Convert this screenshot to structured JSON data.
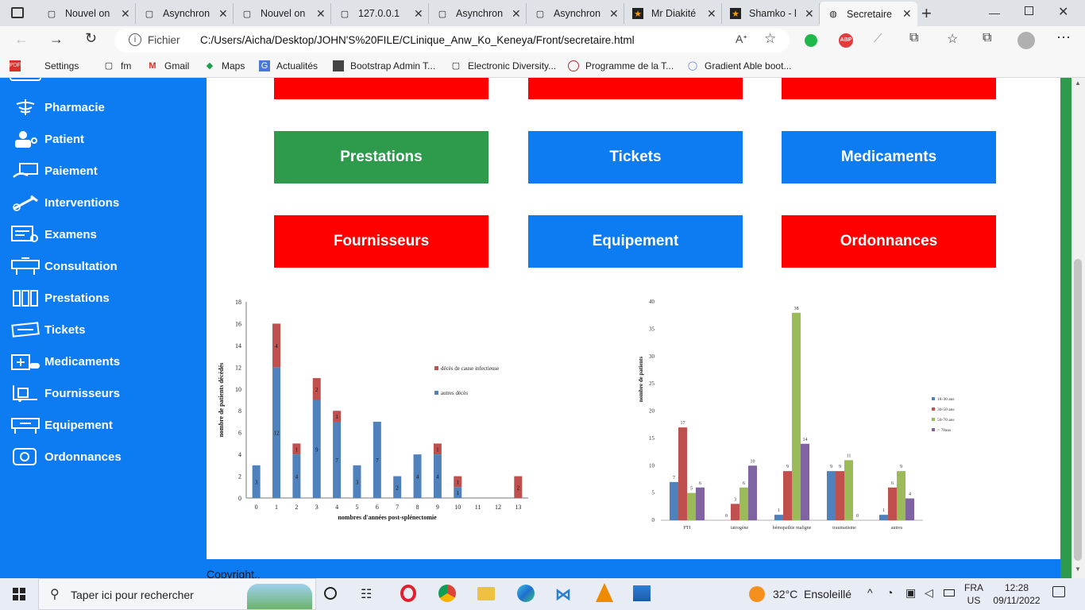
{
  "browser": {
    "tabs": [
      {
        "label": "Nouvel on",
        "icon": "page-icon"
      },
      {
        "label": "Asynchron",
        "icon": "page-icon"
      },
      {
        "label": "Nouvel on",
        "icon": "page-icon"
      },
      {
        "label": "127.0.0.1",
        "icon": "page-icon"
      },
      {
        "label": "Asynchron",
        "icon": "page-icon"
      },
      {
        "label": "Asynchron",
        "icon": "page-icon"
      },
      {
        "label": "Mr Diakité",
        "icon": "star-icon"
      },
      {
        "label": "Shamko - l",
        "icon": "star-icon"
      },
      {
        "label": "Secretaire",
        "icon": "globe-icon"
      }
    ],
    "address_label": "Fichier",
    "url": "C:/Users/Aicha/Desktop/JOHN'S%20FILE/CLinique_Anw_Ko_Keneya/Front/secretaire.html",
    "bookmarks": [
      "Settings",
      "fm",
      "Gmail",
      "Maps",
      "Actualités",
      "Bootstrap Admin T...",
      "Electronic Diversity...",
      "Programme de la T...",
      "Gradient Able boot..."
    ]
  },
  "sidebar": {
    "items": [
      {
        "label": "Pharmacie"
      },
      {
        "label": "Patient"
      },
      {
        "label": "Paiement"
      },
      {
        "label": "Interventions"
      },
      {
        "label": "Examens"
      },
      {
        "label": "Consultation"
      },
      {
        "label": "Prestations"
      },
      {
        "label": "Tickets"
      },
      {
        "label": "Medicaments"
      },
      {
        "label": "Fournisseurs"
      },
      {
        "label": "Equipement"
      },
      {
        "label": "Ordonnances"
      }
    ]
  },
  "main": {
    "tiles": [
      {
        "label": "Prestations",
        "color": "#2e9b4c"
      },
      {
        "label": "Tickets",
        "color": "#0d7cf2"
      },
      {
        "label": "Medicaments",
        "color": "#0d7cf2"
      },
      {
        "label": "Fournisseurs",
        "color": "#ff0000"
      },
      {
        "label": "Equipement",
        "color": "#0d7cf2"
      },
      {
        "label": "Ordonnances",
        "color": "#ff0000"
      }
    ],
    "copyright": "Copyright.."
  },
  "chart_data": [
    {
      "type": "bar",
      "stacked": true,
      "categories": [
        "0",
        "1",
        "2",
        "3",
        "4",
        "5",
        "6",
        "7",
        "8",
        "9",
        "10",
        "11",
        "12",
        "13"
      ],
      "series": [
        {
          "name": "autres décès",
          "values": [
            3,
            12,
            4,
            9,
            7,
            3,
            7,
            2,
            4,
            4,
            1,
            0,
            0,
            0
          ],
          "color": "#4f81bd"
        },
        {
          "name": "décès de cause infectieuse",
          "values": [
            0,
            4,
            1,
            2,
            1,
            0,
            0,
            0,
            0,
            1,
            1,
            0,
            0,
            2
          ],
          "color": "#c0504d"
        }
      ],
      "xlabel": "nombres d'années post-splénectomie",
      "ylabel": "nombre de patients décédés",
      "ylim": [
        0,
        18
      ],
      "yticks": [
        "0",
        "2",
        "4",
        "6",
        "8",
        "10",
        "12",
        "14",
        "16",
        "18"
      ],
      "legend": "right"
    },
    {
      "type": "bar",
      "categories": [
        "PTI",
        "iatrogène",
        "hémopathie maligne",
        "traumatisme",
        "autres"
      ],
      "series": [
        {
          "name": "18-30 ans",
          "values": [
            7,
            0,
            1,
            9,
            1
          ],
          "color": "#4f81bd"
        },
        {
          "name": "30-50 ans",
          "values": [
            17,
            3,
            9,
            9,
            6
          ],
          "color": "#c0504d"
        },
        {
          "name": "50-70 ans",
          "values": [
            5,
            6,
            38,
            11,
            9
          ],
          "color": "#9bbb59"
        },
        {
          "name": "> 70ans",
          "values": [
            6,
            10,
            14,
            0,
            4
          ],
          "color": "#8064a2"
        }
      ],
      "ylabel": "nombre de patients",
      "ylim": [
        0,
        40
      ],
      "yticks": [
        "0",
        "5",
        "10",
        "15",
        "20",
        "25",
        "30",
        "35",
        "40"
      ],
      "legend": "right"
    }
  ],
  "taskbar": {
    "search_placeholder": "Taper ici pour rechercher",
    "weather": "32°C  Ensoleillé",
    "lang": "FRA",
    "lang_sub": "US",
    "time": "12:28",
    "date": "09/11/2022"
  }
}
